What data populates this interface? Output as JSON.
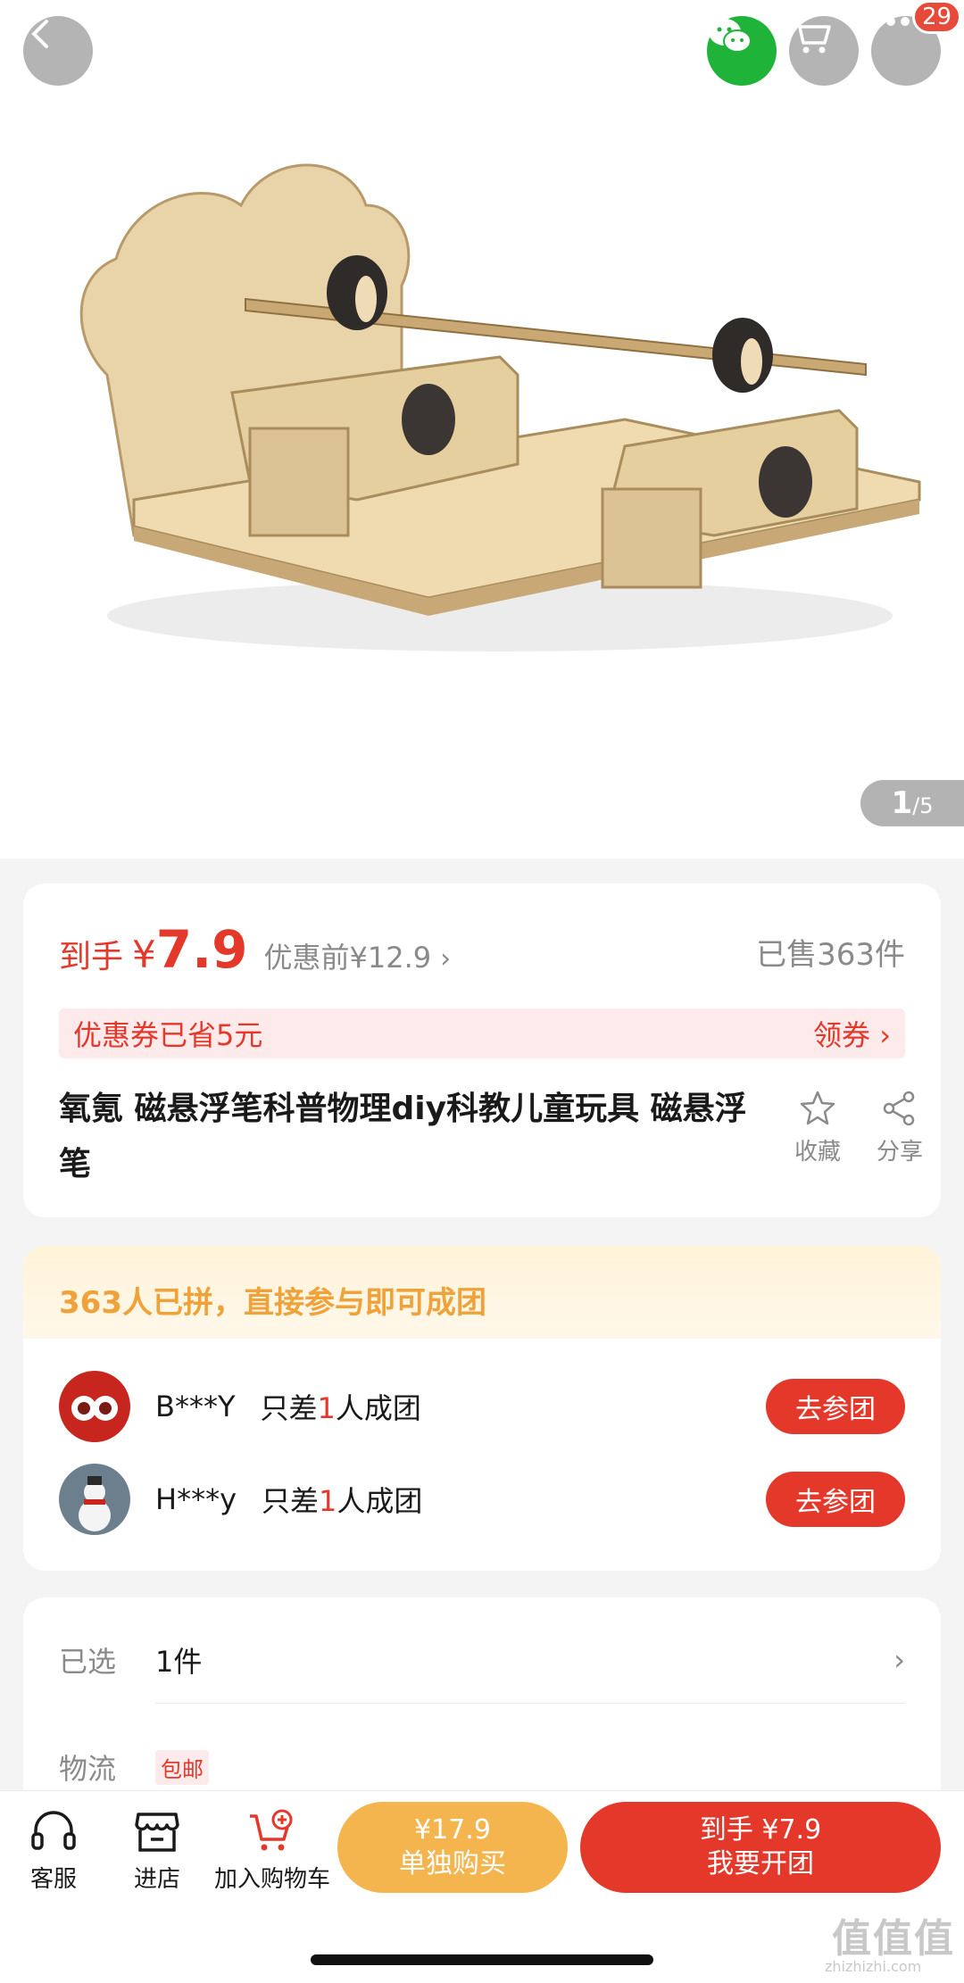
{
  "header": {
    "badge_count": "29"
  },
  "gallery": {
    "current": "1",
    "total": "/5"
  },
  "price": {
    "label": "到手",
    "currency": "¥",
    "value": "7.9",
    "original": "优惠前¥12.9",
    "chevron": "›",
    "sold": "已售363件"
  },
  "coupon": {
    "text": "优惠券已省5元",
    "action": "领券 ›"
  },
  "product": {
    "title": "氧氪 磁悬浮笔科普物理diy科教儿童玩具 磁悬浮笔",
    "favorite_label": "收藏",
    "share_label": "分享"
  },
  "group": {
    "header": "363人已拼，直接参与即可成团",
    "rows": [
      {
        "name": "B***Y",
        "text_before": "只差",
        "count": "1",
        "text_after": "人成团",
        "button": "去参团"
      },
      {
        "name": "H***y",
        "text_before": "只差",
        "count": "1",
        "text_after": "人成团",
        "button": "去参团"
      }
    ]
  },
  "options": {
    "selected_label": "已选",
    "selected_value": "1件",
    "shipping_label": "物流",
    "shipping_tag": "包邮"
  },
  "bottom": {
    "service_label": "客服",
    "store_label": "进店",
    "cart_label": "加入购物车",
    "single_price": "¥17.9",
    "single_label": "单独购买",
    "group_price": "到手 ¥7.9",
    "group_label": "我要开团"
  },
  "watermark": {
    "text": "值值值",
    "sub": "zhizhizhi.com"
  },
  "colors": {
    "accent_red": "#e4382b",
    "group_orange": "#f0a23a",
    "single_btn": "#f4b54f",
    "wechat_green": "#1fb33a"
  }
}
